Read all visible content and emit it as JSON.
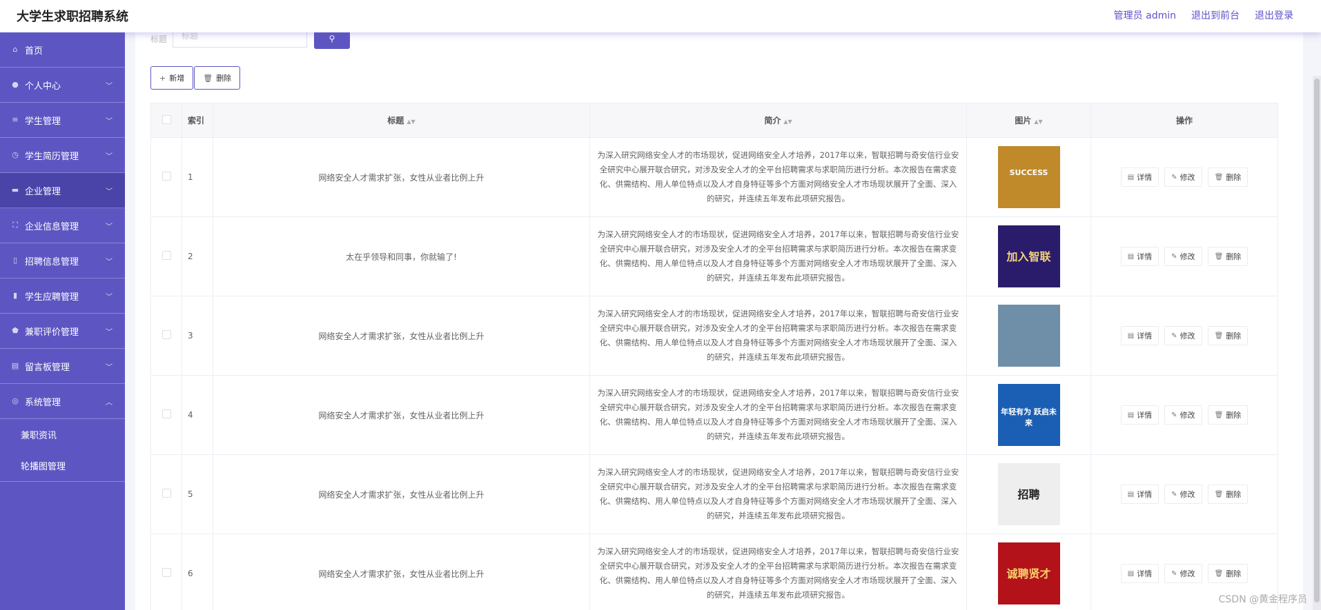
{
  "app": {
    "title": "大学生求职招聘系统"
  },
  "top_links": {
    "user": "管理员 admin",
    "front": "退出到前台",
    "logout": "退出登录"
  },
  "menu": [
    {
      "label": "首页",
      "icon": "home-icon",
      "expandable": false,
      "active": false
    },
    {
      "label": "个人中心",
      "icon": "user-icon",
      "expandable": true,
      "active": false
    },
    {
      "label": "学生管理",
      "icon": "list-icon",
      "expandable": true,
      "active": false
    },
    {
      "label": "学生简历管理",
      "icon": "clock-icon",
      "expandable": true,
      "active": false
    },
    {
      "label": "企业管理",
      "icon": "building-icon",
      "expandable": true,
      "active": true
    },
    {
      "label": "企业信息管理",
      "icon": "frame-icon",
      "expandable": true,
      "active": false
    },
    {
      "label": "招聘信息管理",
      "icon": "phone-icon",
      "expandable": true,
      "active": false
    },
    {
      "label": "学生应聘管理",
      "icon": "chart-icon",
      "expandable": true,
      "active": false
    },
    {
      "label": "兼职评价管理",
      "icon": "shield-icon",
      "expandable": true,
      "active": false
    },
    {
      "label": "留言板管理",
      "icon": "clipboard-icon",
      "expandable": true,
      "active": false
    },
    {
      "label": "系统管理",
      "icon": "compass-icon",
      "expandable": true,
      "expanded": true,
      "active": false
    }
  ],
  "submenu": [
    "兼职资讯",
    "轮播图管理"
  ],
  "search": {
    "label": "标题",
    "placeholder": "标题"
  },
  "buttons": {
    "add": "新增",
    "delete": "删除"
  },
  "table": {
    "headers": {
      "index": "索引",
      "title": "标题",
      "intro": "简介",
      "image": "图片",
      "ops": "操作"
    },
    "op_labels": {
      "detail": "详情",
      "edit": "修改",
      "delete": "删除"
    },
    "rows": [
      {
        "index": "1",
        "title": "网络安全人才需求扩张，女性从业者比例上升",
        "intro": "为深入研究网络安全人才的市场现状，促进网络安全人才培养，2017年以来，智联招聘与奇安信行业安全研究中心展开联合研究，对涉及安全人才的全平台招聘需求与求职简历进行分析。本次报告在需求变化、供需结构、用人单位特点以及人才自身特征等多个方面对网络安全人才市场现状展开了全面、深入的研究，并连续五年发布此项研究报告。",
        "image_text": "SUCCESS",
        "image_bg": "#c08a2a",
        "image_fg": "#fff"
      },
      {
        "index": "2",
        "title": "太在乎领导和同事，你就输了!",
        "intro": "为深入研究网络安全人才的市场现状，促进网络安全人才培养，2017年以来，智联招聘与奇安信行业安全研究中心展开联合研究，对涉及安全人才的全平台招聘需求与求职简历进行分析。本次报告在需求变化、供需结构、用人单位特点以及人才自身特征等多个方面对网络安全人才市场现状展开了全面、深入的研究，并连续五年发布此项研究报告。",
        "image_text": "加入智联",
        "image_bg": "#2a1c6b",
        "image_fg": "#f3d27a"
      },
      {
        "index": "3",
        "title": "网络安全人才需求扩张，女性从业者比例上升",
        "intro": "为深入研究网络安全人才的市场现状，促进网络安全人才培养，2017年以来，智联招聘与奇安信行业安全研究中心展开联合研究，对涉及安全人才的全平台招聘需求与求职简历进行分析。本次报告在需求变化、供需结构、用人单位特点以及人才自身特征等多个方面对网络安全人才市场现状展开了全面、深入的研究，并连续五年发布此项研究报告。",
        "image_text": "",
        "image_bg": "#6f8fa8",
        "image_fg": "#fff"
      },
      {
        "index": "4",
        "title": "网络安全人才需求扩张，女性从业者比例上升",
        "intro": "为深入研究网络安全人才的市场现状，促进网络安全人才培养，2017年以来，智联招聘与奇安信行业安全研究中心展开联合研究，对涉及安全人才的全平台招聘需求与求职简历进行分析。本次报告在需求变化、供需结构、用人单位特点以及人才自身特征等多个方面对网络安全人才市场现状展开了全面、深入的研究，并连续五年发布此项研究报告。",
        "image_text": "年轻有为 跃启未来",
        "image_bg": "#1a5fb4",
        "image_fg": "#fff"
      },
      {
        "index": "5",
        "title": "网络安全人才需求扩张，女性从业者比例上升",
        "intro": "为深入研究网络安全人才的市场现状，促进网络安全人才培养，2017年以来，智联招聘与奇安信行业安全研究中心展开联合研究，对涉及安全人才的全平台招聘需求与求职简历进行分析。本次报告在需求变化、供需结构、用人单位特点以及人才自身特征等多个方面对网络安全人才市场现状展开了全面、深入的研究，并连续五年发布此项研究报告。",
        "image_text": "招聘",
        "image_bg": "#eeeeee",
        "image_fg": "#222"
      },
      {
        "index": "6",
        "title": "网络安全人才需求扩张，女性从业者比例上升",
        "intro": "为深入研究网络安全人才的市场现状，促进网络安全人才培养，2017年以来，智联招聘与奇安信行业安全研究中心展开联合研究，对涉及安全人才的全平台招聘需求与求职简历进行分析。本次报告在需求变化、供需结构、用人单位特点以及人才自身特征等多个方面对网络安全人才市场现状展开了全面、深入的研究，并连续五年发布此项研究报告。",
        "image_text": "诚聘贤才",
        "image_bg": "#b3121a",
        "image_fg": "#f6d36b"
      }
    ]
  },
  "watermark": "CSDN @黄金程序员"
}
